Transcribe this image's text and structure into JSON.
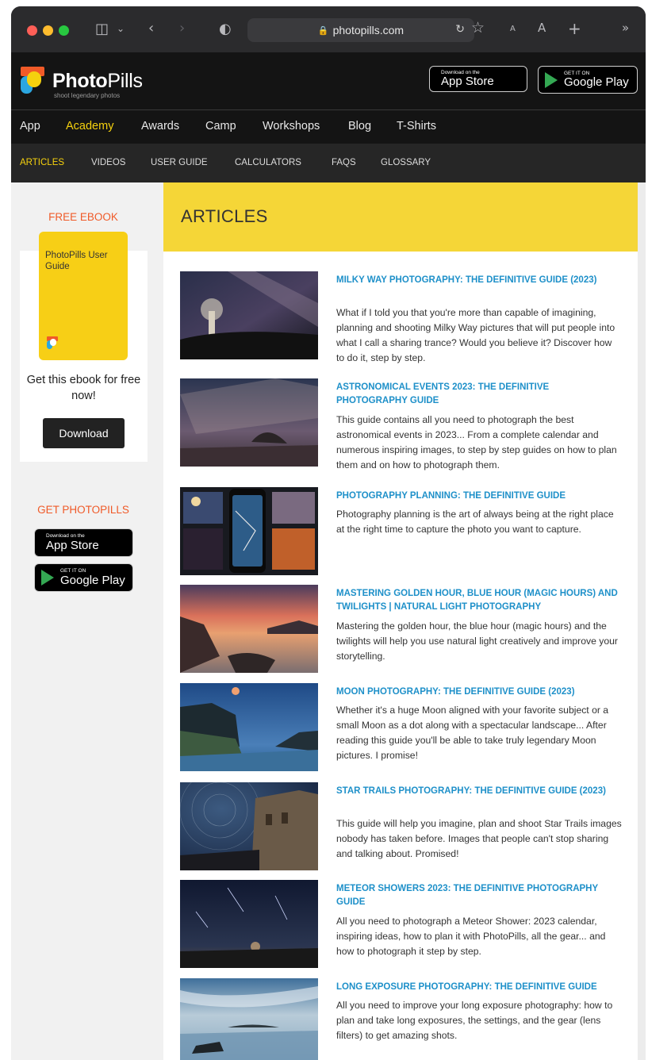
{
  "browser": {
    "url": "photopills.com",
    "reader_small_a": "A",
    "reader_big_a": "A"
  },
  "brand": {
    "name_bold": "Photo",
    "name_light": "Pills",
    "tagline": "shoot legendary photos",
    "accent": "#f5d10e",
    "link_color": "#1e90c9",
    "heading_orange": "#f05a28"
  },
  "badges": {
    "appstore_small": "Download on the",
    "appstore_big": "App Store",
    "googleplay_small": "GET IT ON",
    "googleplay_big": "Google Play"
  },
  "main_nav": [
    "App",
    "Academy",
    "Awards",
    "Camp",
    "Workshops",
    "Blog",
    "T-Shirts"
  ],
  "sub_nav": [
    "ARTICLES",
    "VIDEOS",
    "USER GUIDE",
    "CALCULATORS",
    "FAQS",
    "GLOSSARY"
  ],
  "sidebar": {
    "ebook_heading": "FREE EBOOK",
    "ebook_title": "PhotoPills User Guide",
    "cta": "Get this ebook for free now!",
    "download_label": "Download",
    "get_heading": "GET PHOTOPILLS"
  },
  "page_title": "ARTICLES",
  "articles": [
    {
      "title": "MILKY WAY PHOTOGRAPHY: THE DEFINITIVE GUIDE (2023)",
      "excerpt": "What if I told you that you're more than capable of imagining, planning and shooting Milky Way pictures that will put people into what I call a sharing trance? Would you believe it? Discover how to do it, step by step."
    },
    {
      "title": "ASTRONOMICAL EVENTS 2023: THE DEFINITIVE PHOTOGRAPHY GUIDE",
      "excerpt": "This guide contains all you need to photograph the best astronomical events in 2023... From a complete calendar and numerous inspiring images, to step by step guides on how to plan them and on how to photograph them."
    },
    {
      "title": "PHOTOGRAPHY PLANNING: THE DEFINITIVE GUIDE",
      "excerpt": "Photography planning is the art of always being at the right place at the right time to capture the photo you want to capture."
    },
    {
      "title": "MASTERING GOLDEN HOUR, BLUE HOUR (MAGIC HOURS) AND TWILIGHTS | NATURAL LIGHT PHOTOGRAPHY",
      "excerpt": "Mastering the golden hour, the blue hour (magic hours) and the twilights will help you use natural light creatively and improve your storytelling."
    },
    {
      "title": "MOON PHOTOGRAPHY: THE DEFINITIVE GUIDE (2023)",
      "excerpt": "Whether it's a huge Moon aligned with your favorite subject or a small Moon as a dot along with a spectacular landscape... After reading this guide you'll be able to take truly legendary Moon pictures. I promise!"
    },
    {
      "title": "STAR TRAILS PHOTOGRAPHY: THE DEFINITIVE GUIDE (2023)",
      "excerpt": "This guide will help you imagine, plan and shoot Star Trails images nobody has taken before. Images that people can't stop sharing and talking about. Promised!"
    },
    {
      "title": "METEOR SHOWERS 2023: THE DEFINITIVE PHOTOGRAPHY GUIDE",
      "excerpt": "All you need to photograph a Meteor Shower: 2023 calendar, inspiring ideas, how to plan it with PhotoPills, all the gear... and how to photograph it step by step."
    },
    {
      "title": "LONG EXPOSURE PHOTOGRAPHY: THE DEFINITIVE GUIDE",
      "excerpt": "All you need to improve your long exposure photography: how to plan and take long exposures, the settings, and the gear (lens filters) to get amazing shots."
    }
  ]
}
